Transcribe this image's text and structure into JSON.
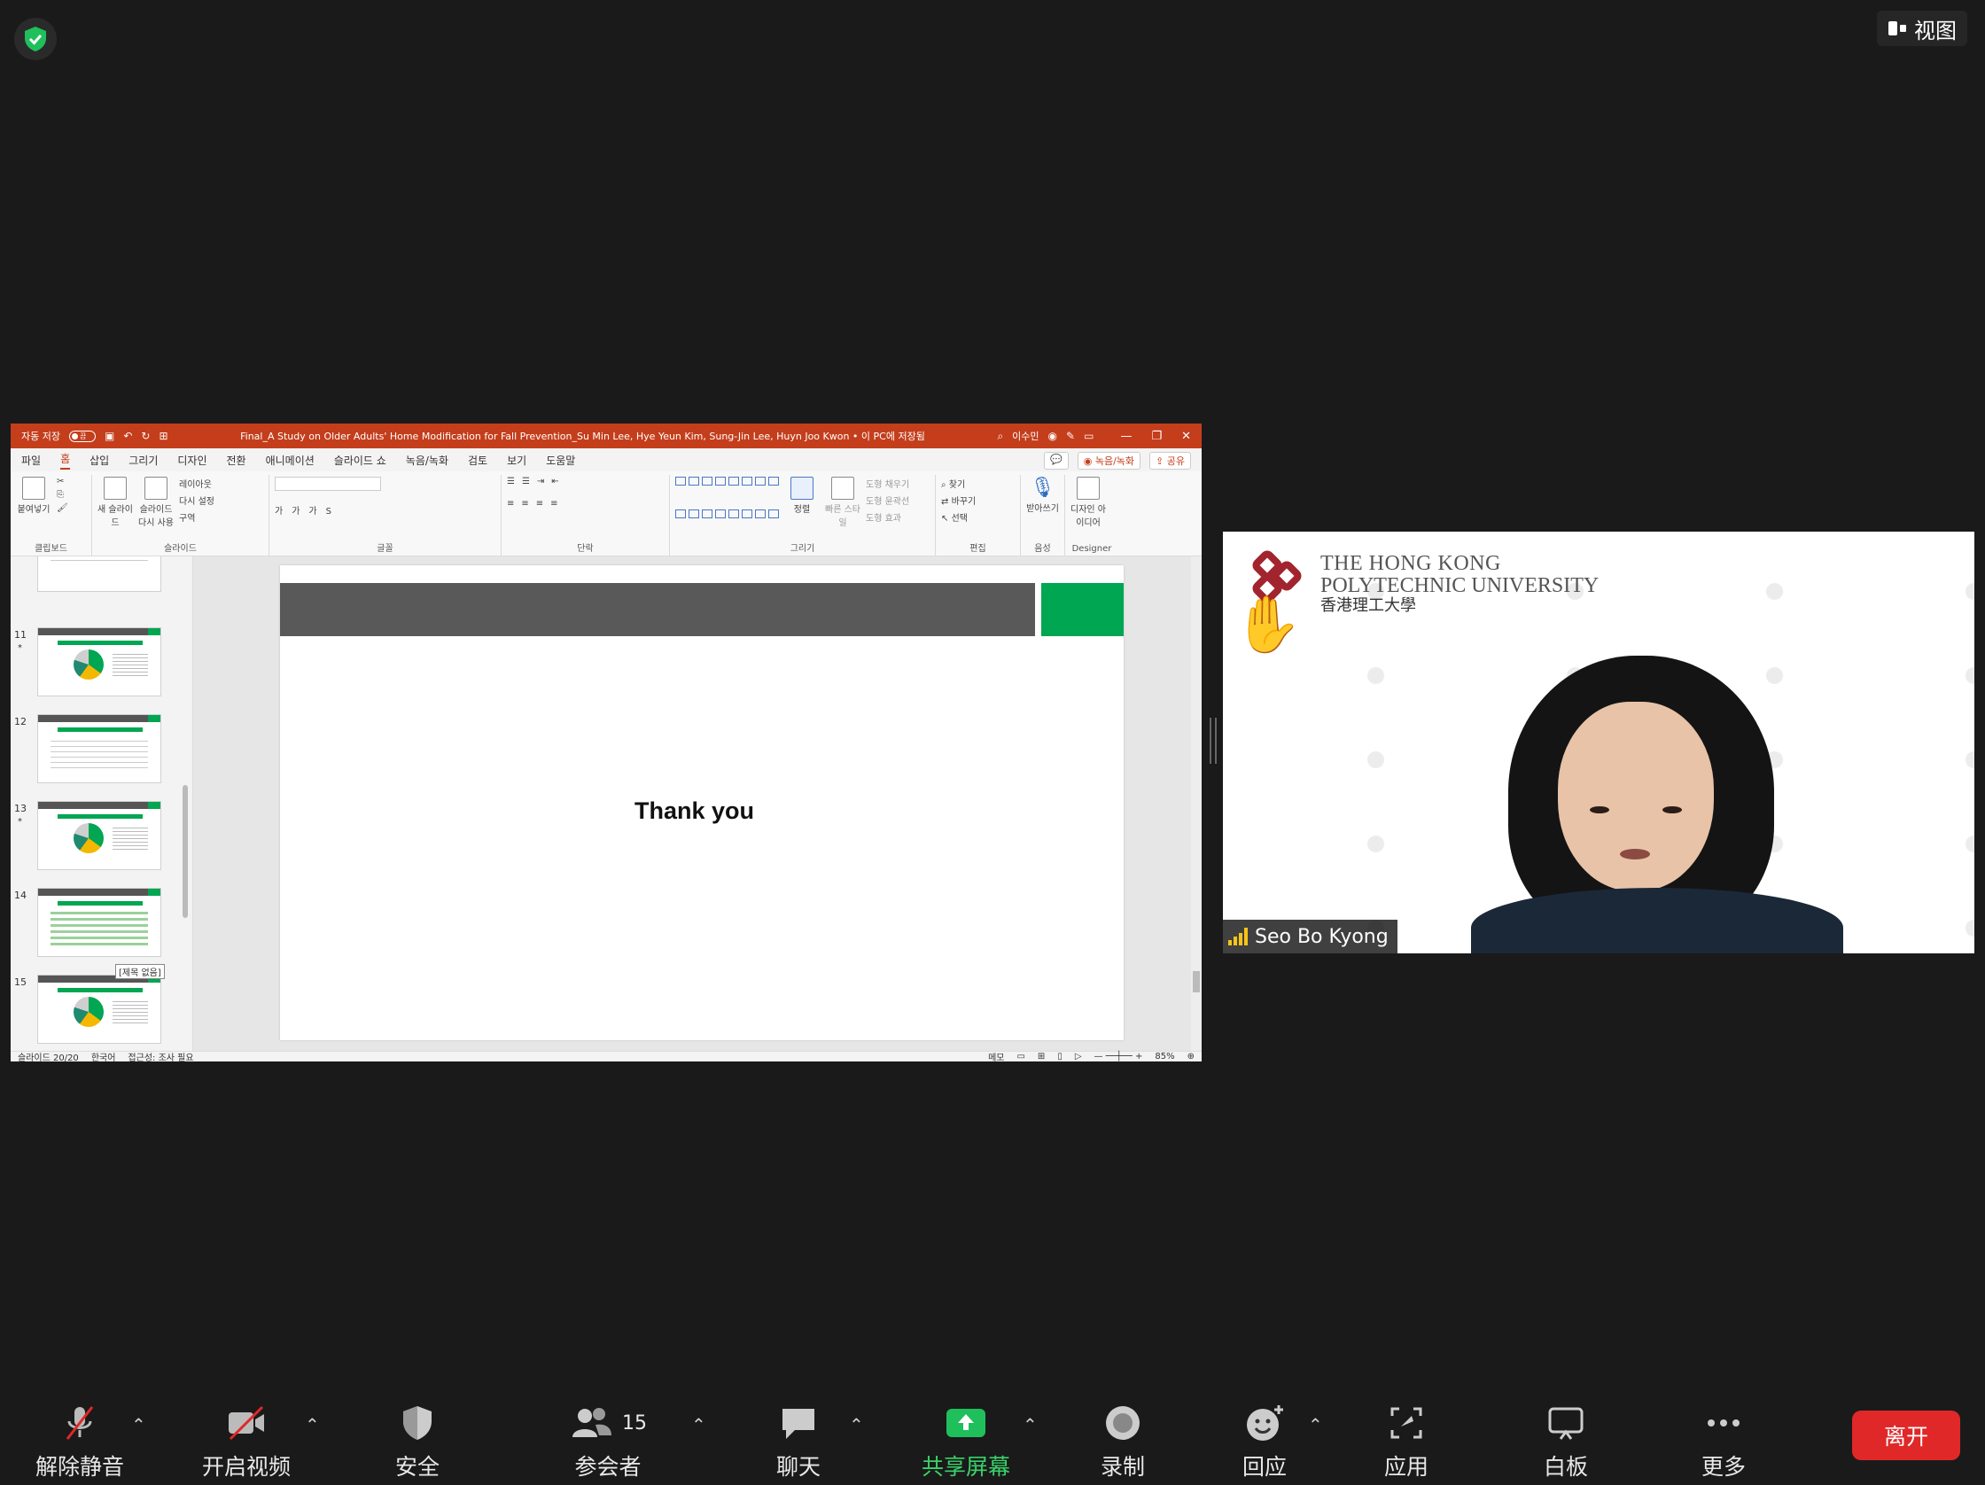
{
  "top": {
    "view_label": "视图"
  },
  "ppt": {
    "autosave_label": "자동 저장",
    "autosave_state": "끔",
    "doc_title": "Final_A Study on Older Adults' Home Modification for Fall Prevention_Su Min Lee, Hye Yeun Kim, Sung-Jin Lee, Huyn Joo Kwon • 이 PC에 저장됨",
    "user_name": "이수민",
    "menu": [
      "파일",
      "홈",
      "삽입",
      "그리기",
      "디자인",
      "전환",
      "애니메이션",
      "슬라이드 쇼",
      "녹음/녹화",
      "검토",
      "보기",
      "도움말"
    ],
    "record_btn": "녹음/녹화",
    "share_btn": "공유",
    "ribbon": {
      "clipboard": {
        "paste": "붙여넣기",
        "label": "클립보드"
      },
      "slides": {
        "new_slide": "새 슬라이드",
        "reuse": "슬라이드 다시 사용",
        "layout": "레이아웃",
        "reset": "다시 설정",
        "section": "구역",
        "label": "슬라이드"
      },
      "font_label": "글꼴",
      "paragraph_label": "단락",
      "drawing": {
        "arrange": "정렬",
        "quick_styles": "빠른 스타일",
        "fill": "도형 채우기",
        "outline": "도형 윤곽선",
        "effects": "도형 효과",
        "label": "그리기"
      },
      "editing": {
        "find": "찾기",
        "replace": "바꾸기",
        "select": "선택",
        "label": "편집"
      },
      "voice": {
        "dictate": "받아쓰기",
        "label": "음성"
      },
      "designer": {
        "ideas": "디자인 아이디어",
        "label": "Designer"
      }
    },
    "thumbnails": [
      {
        "num": "11",
        "star": "*"
      },
      {
        "num": "12",
        "star": ""
      },
      {
        "num": "13",
        "star": "*"
      },
      {
        "num": "14",
        "star": ""
      },
      {
        "num": "15",
        "star": ""
      }
    ],
    "tooltip": "[제목 없음]",
    "slide_text": "Thank you",
    "status": {
      "slide_count": "슬라이드 20/20",
      "language": "한국어",
      "accessibility": "접근성: 조사 필요",
      "notes": "메모",
      "zoom": "85%"
    }
  },
  "video": {
    "org_line1": "THE HONG KONG",
    "org_line2": "POLYTECHNIC UNIVERSITY",
    "org_line3": "香港理工大學",
    "reaction": "✋",
    "participant_name": "Seo Bo Kyong"
  },
  "toolbar": {
    "unmute": "解除静音",
    "start_video": "开启视频",
    "security": "安全",
    "participants": "参会者",
    "participants_count": "15",
    "chat": "聊天",
    "share_screen": "共享屏幕",
    "record": "录制",
    "reactions": "回应",
    "apps": "应用",
    "whiteboard": "白板",
    "more": "更多",
    "leave": "离开"
  },
  "colors": {
    "share_green": "#38d26a",
    "leave_red": "#e02828",
    "ppt_accent": "#c43e1c",
    "slide_green": "#00a651"
  }
}
